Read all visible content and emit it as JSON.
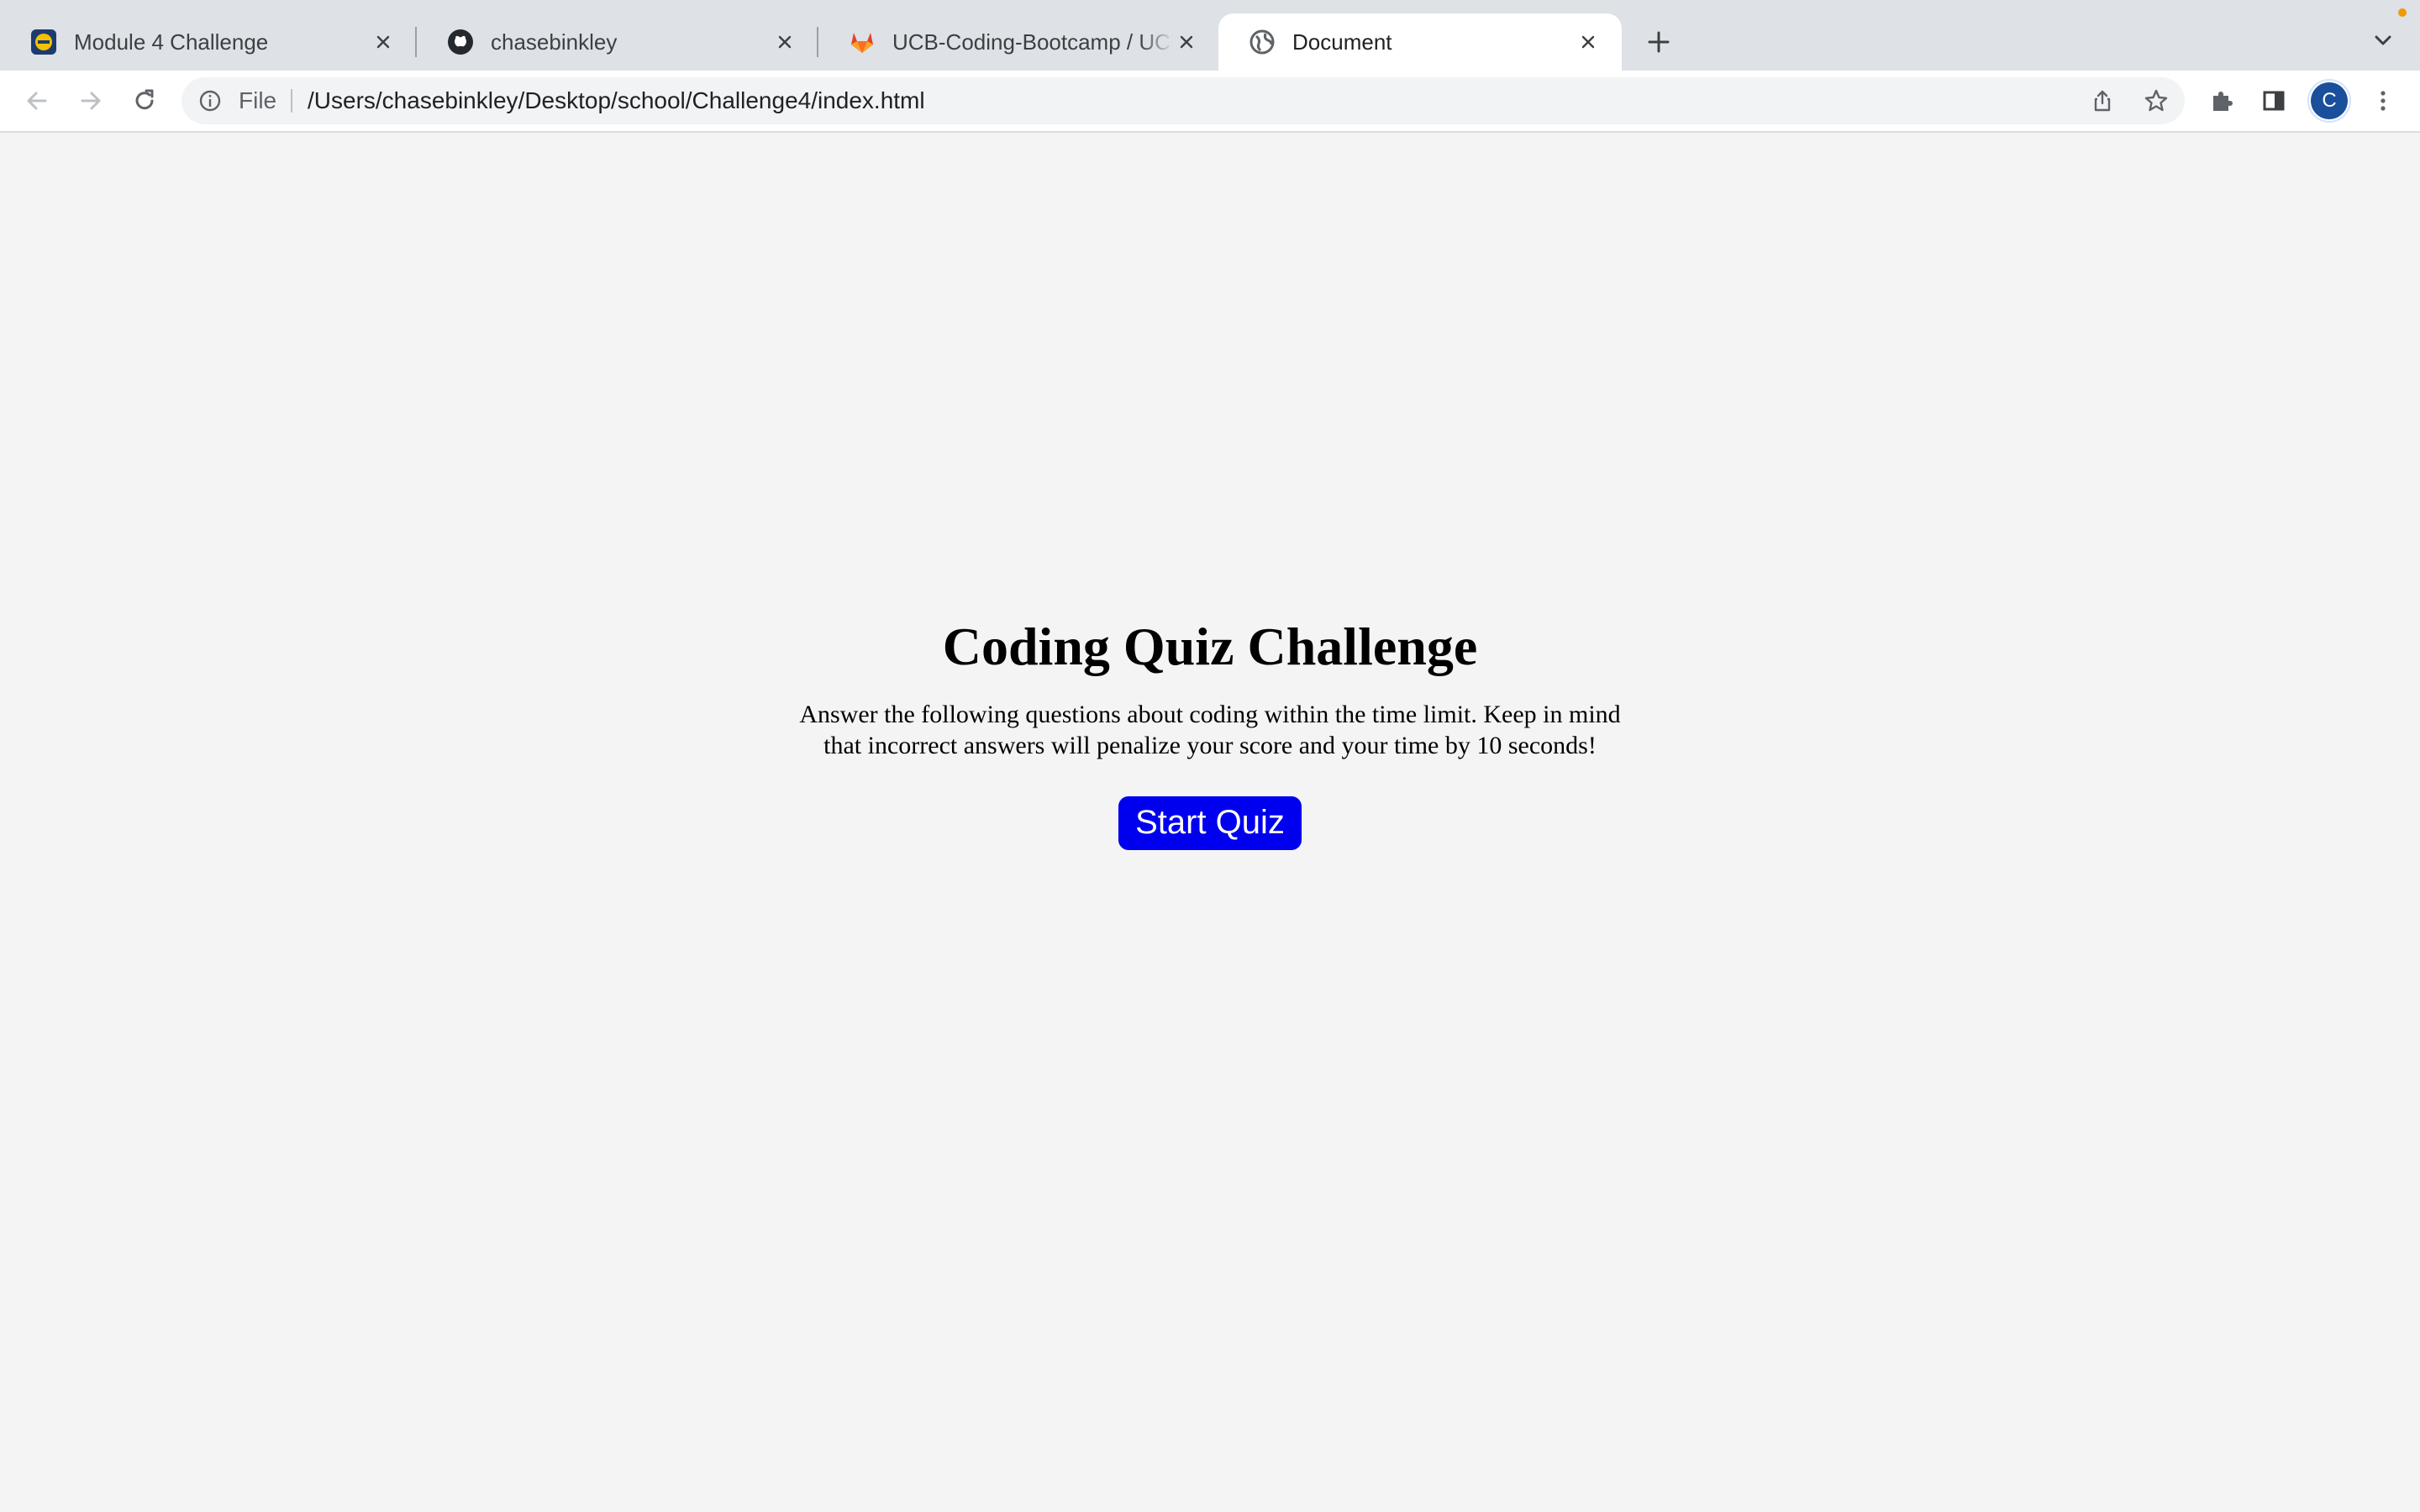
{
  "browser": {
    "tabs": [
      {
        "title": "Module 4 Challenge",
        "favicon": "bootcamp-logo-icon",
        "active": false
      },
      {
        "title": "chasebinkley",
        "favicon": "github-icon",
        "active": false
      },
      {
        "title": "UCB-Coding-Bootcamp / UCB-",
        "favicon": "gitlab-icon",
        "active": false
      },
      {
        "title": "Document",
        "favicon": "globe-icon",
        "active": true
      }
    ],
    "omnibox": {
      "scheme_label": "File",
      "url": "/Users/chasebinkley/Desktop/school/Challenge4/index.html"
    },
    "profile_initial": "C",
    "colors": {
      "tabstrip": "#dee1e6",
      "toolbar": "#ffffff",
      "omnibox": "#f1f3f4",
      "avatar": "#1a4f9c"
    }
  },
  "page": {
    "title": "Coding Quiz Challenge",
    "description": "Answer the following questions about coding within the time limit. Keep in mind that incorrect answers will penalize your score and your time by 10 seconds!",
    "start_button_label": "Start Quiz",
    "colors": {
      "background": "#f4f4f4",
      "button": "#0000ee",
      "button_text": "#ffffff"
    }
  }
}
